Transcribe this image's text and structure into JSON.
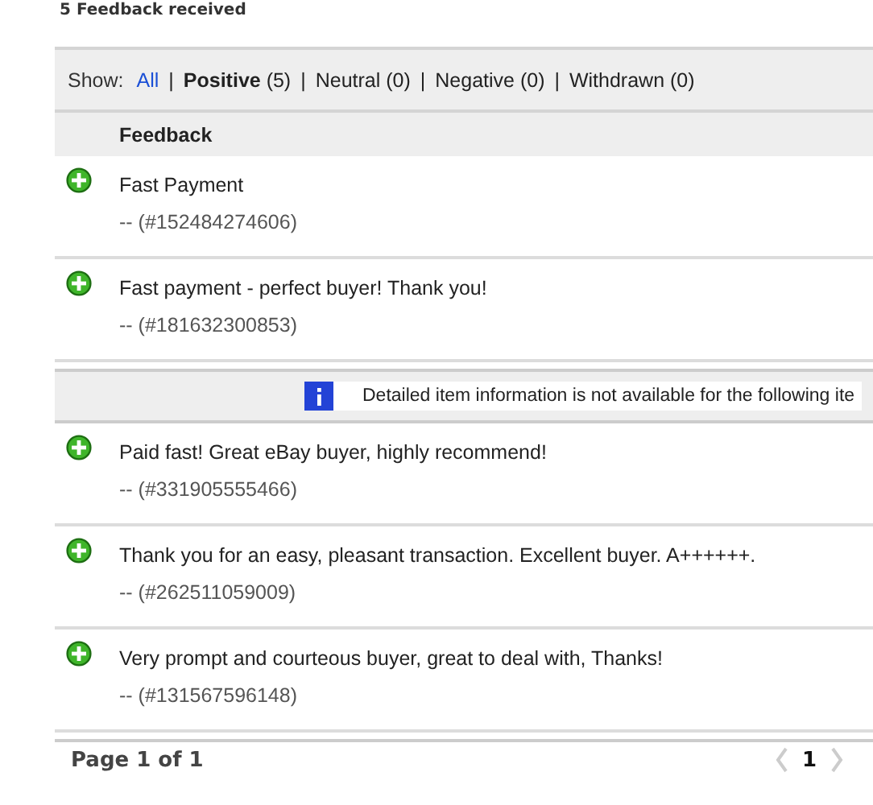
{
  "heading": "5 Feedback received",
  "filters_label": "Show:",
  "separator": "|",
  "filters": [
    {
      "kind": "link",
      "label": "All",
      "selected": false
    },
    {
      "kind": "filter",
      "label": "Positive",
      "count": "(5)",
      "selected": true
    },
    {
      "kind": "filter",
      "label": "Neutral",
      "count": "(0)",
      "selected": false
    },
    {
      "kind": "filter",
      "label": "Negative",
      "count": "(0)",
      "selected": false
    },
    {
      "kind": "filter",
      "label": "Withdrawn",
      "count": "(0)",
      "selected": false
    }
  ],
  "table": {
    "column": "Feedback",
    "rows": [
      {
        "kind": "positive",
        "comment": "Fast Payment",
        "item": "-- (#152484274606)"
      },
      {
        "kind": "positive",
        "comment": "Fast payment - perfect buyer! Thank you!",
        "item": "-- (#181632300853)"
      },
      {
        "kind": "notice",
        "text": "Detailed item information is not available for the following ite"
      },
      {
        "kind": "positive",
        "comment": "Paid fast! Great eBay buyer, highly recommend!",
        "item": "-- (#331905555466)"
      },
      {
        "kind": "positive",
        "comment": "Thank you for an easy, pleasant transaction. Excellent buyer. A++++++.",
        "item": "-- (#262511059009)"
      },
      {
        "kind": "positive",
        "comment": "Very prompt and courteous buyer, great to deal with, Thanks!",
        "item": "-- (#131567596148)"
      }
    ]
  },
  "pagination": {
    "summary": "Page 1 of 1",
    "pages": [
      {
        "label": "1",
        "selected": true
      }
    ],
    "prev_disabled": true,
    "next_disabled": true
  }
}
